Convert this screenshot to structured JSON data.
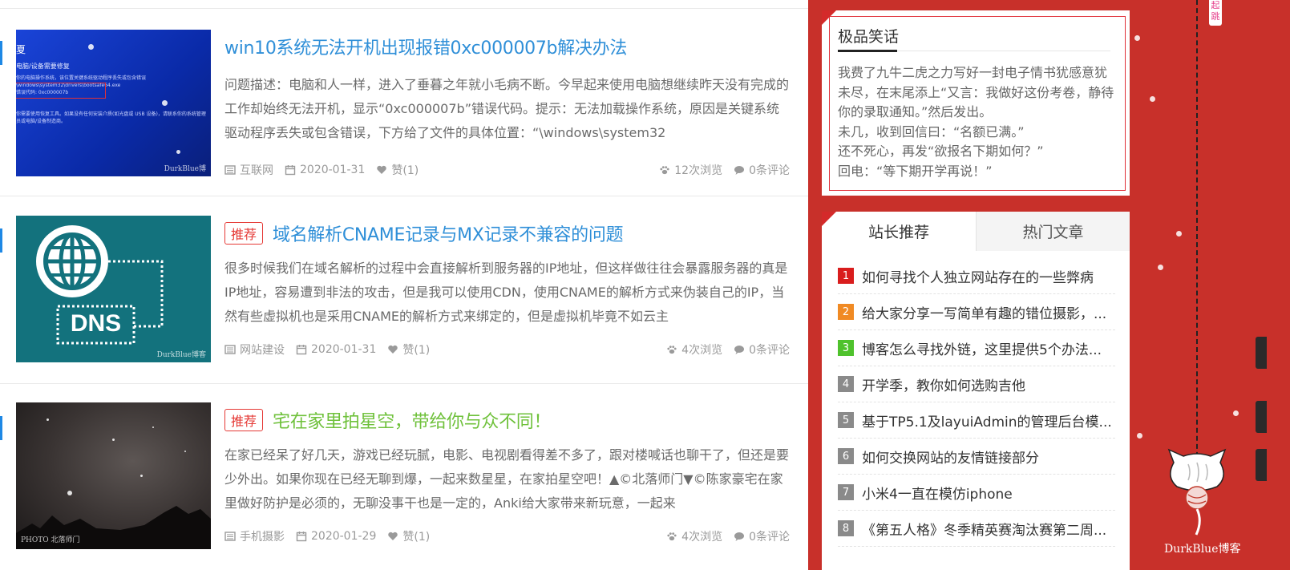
{
  "articles": [
    {
      "badge": "",
      "title": "win10系统无法开机出现报错0xc000007b解决办法",
      "title_color": "#2f8fd8",
      "description": "问题描述：电脑和人一样，进入了垂暮之年就小毛病不断。今早起来使用电脑想继续昨天没有完成的工作却始终无法开机，显示“0xc000007b”错误代码。提示：无法加载操作系统，原因是关键系统驱动程序丢失或包含错误，下方给了文件的具体位置：“\\windows\\system32",
      "category": "互联网",
      "date": "2020-01-31",
      "likes": "赞(1)",
      "views": "12次浏览",
      "comments": "0条评论",
      "thumb": {
        "t1": "夏",
        "t2": "电脑/设备需要修复",
        "t3": "你的电脑操作系统，该位置关键系统驱动程序丢失或包含错误",
        "t3b": "\\windows\\system32\\drivers\\bootsafe64.exe",
        "t3c": "错误代码: 0xc000007b",
        "t4": "你需要使用恢复工具。如果没有任何安装介质(如光盘或 USB 设备)，请联系你的系统管理员或电脑/设备制造商。",
        "watermark": "DurkBlue博"
      }
    },
    {
      "badge": "推荐",
      "title": "域名解析CNAME记录与MX记录不兼容的问题",
      "title_color": "#2f8fd8",
      "description": "很多时候我们在域名解析的过程中会直接解析到服务器的IP地址，但这样做往往会暴露服务器的真是IP地址，容易遭到非法的攻击，但是我可以使用CDN，使用CNAME的解析方式来伪装自己的IP，当然有些虚拟机也是采用CNAME的解析方式来绑定的，但是虚拟机毕竟不如云主",
      "category": "网站建设",
      "date": "2020-01-31",
      "likes": "赞(1)",
      "views": "4次浏览",
      "comments": "0条评论",
      "thumb": {
        "label": "DNS",
        "watermark": "DurkBlue博客"
      }
    },
    {
      "badge": "推荐",
      "title": "宅在家里拍星空，带给你与众不同！",
      "title_color": "#6fc13b",
      "description": "在家已经呆了好几天，游戏已经玩腻，电影、电视剧看得差不多了，跟对楼喊话也聊干了，但还是要少外出。如果你现在已经无聊到爆，一起来数星星，在家拍星空吧！▲©北落师门▼©陈家豪宅在家里做好防护是必须的，无聊没事干也是一定的，Anki给大家带来新玩意，一起来",
      "category": "手机摄影",
      "date": "2020-01-29",
      "likes": "赞(1)",
      "views": "4次浏览",
      "comments": "0条评论",
      "thumb": {
        "watermark": "PHOTO 北落师门"
      }
    }
  ],
  "joke_widget": {
    "title": "极品笑话",
    "lines": [
      "我费了九牛二虎之力写好一封电子情书犹感意犹未尽，在末尾添上“又言：我做好这份考卷，静待你的录取通知。”然后发出。",
      "未几，收到回信曰：“名额已满。”",
      "还不死心，再发“欲报名下期如何？”",
      "回电：“等下期开学再说！”"
    ]
  },
  "recommend_widget": {
    "tabs": [
      "站长推荐",
      "热门文章"
    ],
    "items": [
      {
        "num": "1",
        "color": "#d91d1d",
        "text": "如何寻找个人独立网站存在的一些弊病"
      },
      {
        "num": "2",
        "color": "#f08a24",
        "text": "给大家分享一写简单有趣的错位摄影，..."
      },
      {
        "num": "3",
        "color": "#4fc22c",
        "text": "博客怎么寻找外链，这里提供5个办法..."
      },
      {
        "num": "4",
        "color": "#8a8a8a",
        "text": "开学季，教你如何选购吉他"
      },
      {
        "num": "5",
        "color": "#8a8a8a",
        "text": "基于TP5.1及layuiAdmin的管理后台模..."
      },
      {
        "num": "6",
        "color": "#8a8a8a",
        "text": "如何交换网站的友情链接部分"
      },
      {
        "num": "7",
        "color": "#8a8a8a",
        "text": "小米4一直在模仿iphone"
      },
      {
        "num": "8",
        "color": "#8a8a8a",
        "text": "《第五人格》冬季精英赛淘汰赛第二周..."
      }
    ]
  },
  "side_strip": {
    "badge": "起跳",
    "brand": "DurkBlue博客"
  },
  "colors": {
    "background": "#c8302a",
    "link_blue": "#2f8fd8",
    "badge_red": "#e53935"
  }
}
